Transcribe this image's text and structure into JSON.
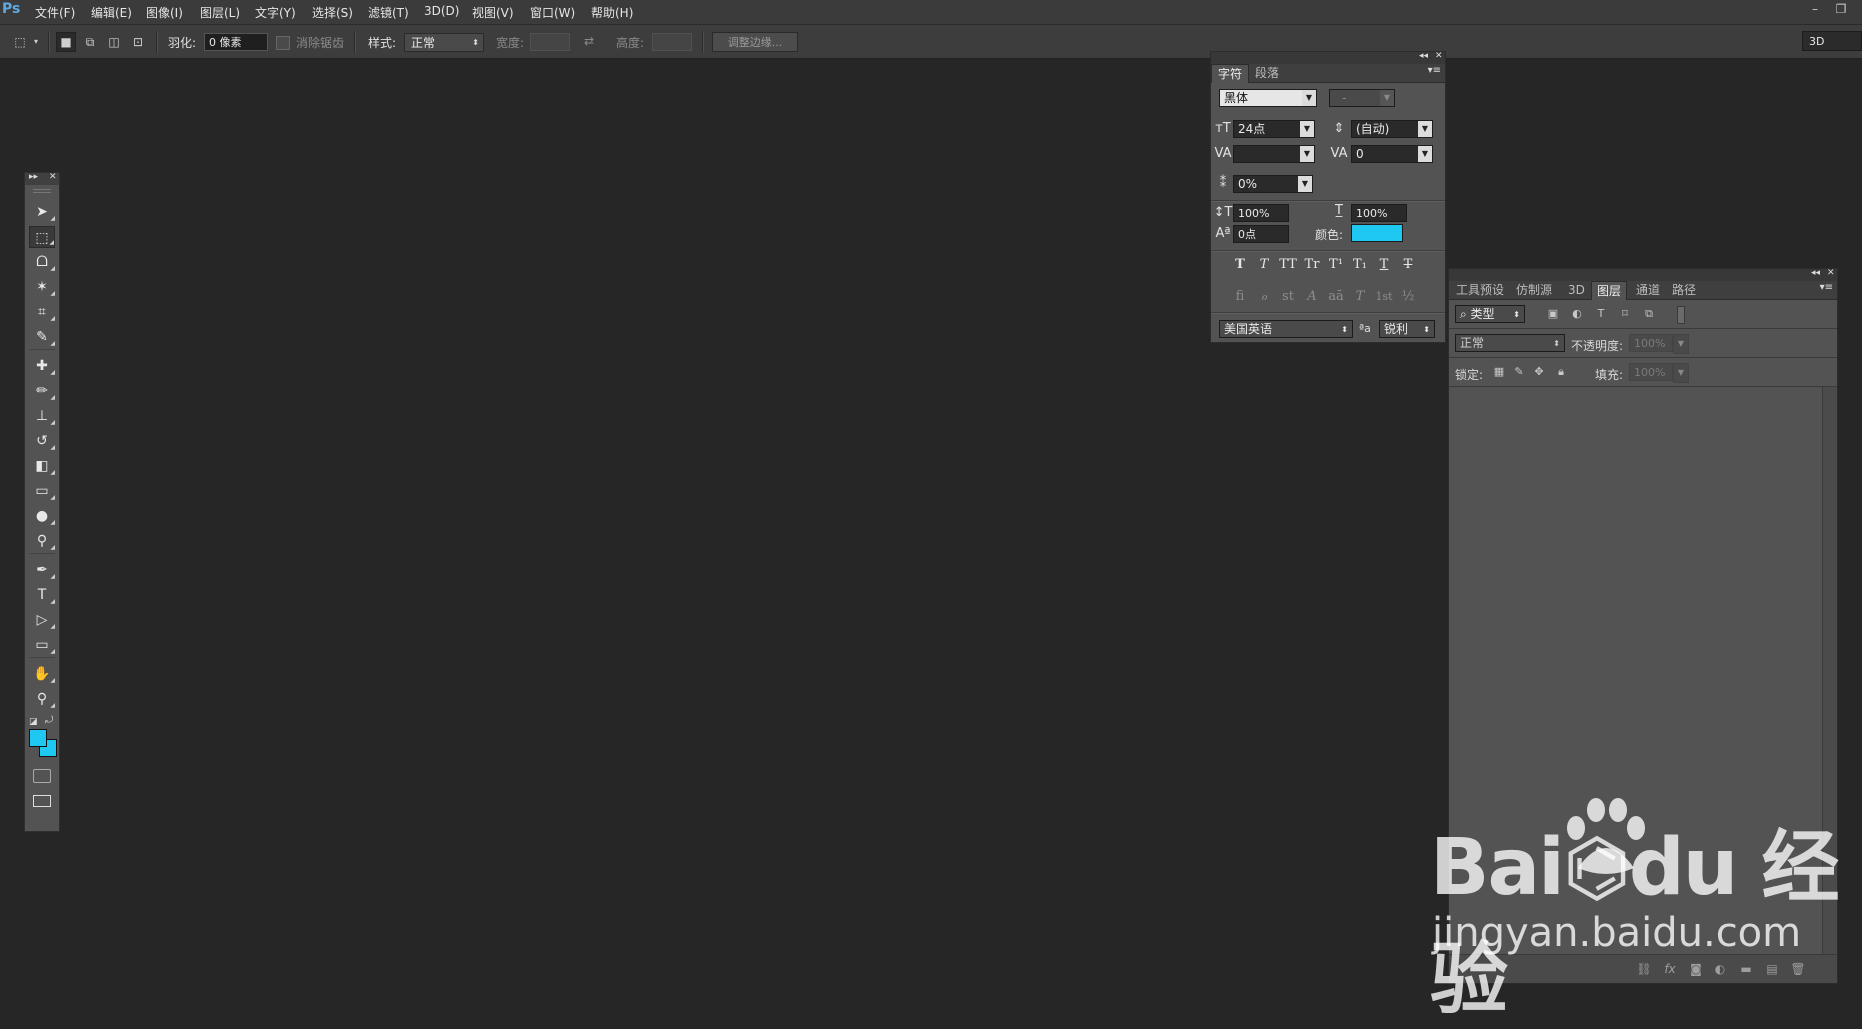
{
  "app": {
    "logo": "Ps"
  },
  "menubar": {
    "items": [
      "文件(F)",
      "编辑(E)",
      "图像(I)",
      "图层(L)",
      "文字(Y)",
      "选择(S)",
      "滤镜(T)",
      "3D(D)",
      "视图(V)",
      "窗口(W)",
      "帮助(H)"
    ],
    "window_controls": [
      "minimize-icon",
      "restore-icon"
    ]
  },
  "options": {
    "feather_label": "羽化:",
    "feather_value": "0 像素",
    "antialias_label": "消除锯齿",
    "style_label": "样式:",
    "style_value": "正常",
    "width_label": "宽度:",
    "height_label": "高度:",
    "refine_edge_label": "调整边缘...",
    "workspace_value": "3D"
  },
  "toolbar": {
    "tools": [
      {
        "name": "move-tool-icon",
        "glyph": "➤"
      },
      {
        "name": "marquee-tool-icon",
        "glyph": "⬚"
      },
      {
        "name": "lasso-tool-icon",
        "glyph": "ᗝ"
      },
      {
        "name": "magic-wand-tool-icon",
        "glyph": "✶"
      },
      {
        "name": "crop-tool-icon",
        "glyph": "⌗"
      },
      {
        "name": "eyedropper-tool-icon",
        "glyph": "✎"
      },
      {
        "name": "healing-brush-tool-icon",
        "glyph": "✚"
      },
      {
        "name": "brush-tool-icon",
        "glyph": "✏"
      },
      {
        "name": "clone-stamp-tool-icon",
        "glyph": "⊥"
      },
      {
        "name": "history-brush-tool-icon",
        "glyph": "↺"
      },
      {
        "name": "eraser-tool-icon",
        "glyph": "◧"
      },
      {
        "name": "gradient-tool-icon",
        "glyph": "▭"
      },
      {
        "name": "blur-tool-icon",
        "glyph": "●"
      },
      {
        "name": "dodge-tool-icon",
        "glyph": "⚲"
      },
      {
        "name": "pen-tool-icon",
        "glyph": "✒"
      },
      {
        "name": "type-tool-icon",
        "glyph": "T"
      },
      {
        "name": "path-selection-tool-icon",
        "glyph": "▷"
      },
      {
        "name": "rectangle-tool-icon",
        "glyph": "▭"
      },
      {
        "name": "hand-tool-icon",
        "glyph": "✋"
      },
      {
        "name": "zoom-tool-icon",
        "glyph": "⚲"
      }
    ],
    "foreground_color": "#1ec8f0",
    "background_color": "#1ec8f0"
  },
  "character_panel": {
    "tabs": [
      "字符",
      "段落"
    ],
    "font_family": "黑体",
    "font_style": "-",
    "font_size": "24点",
    "leading": "(自动)",
    "kerning": "",
    "tracking": "0",
    "tsume": "0%",
    "vertical_scale": "100%",
    "horizontal_scale": "100%",
    "baseline_shift": "0点",
    "color_label": "颜色:",
    "color_value": "#1ec8f0",
    "format_buttons": [
      "T",
      "T",
      "TT",
      "Tr",
      "T¹",
      "T₁",
      "T",
      "T"
    ],
    "opentype_buttons": [
      "fi",
      "ℴ",
      "st",
      "A",
      "aā",
      "T",
      "1st",
      "½"
    ],
    "language": "美国英语",
    "aa_label": "ªa",
    "antialias": "锐利"
  },
  "layers_panel": {
    "tabs": [
      "工具预设",
      "仿制源",
      "3D",
      "图层",
      "通道",
      "路径"
    ],
    "active_tab": "图层",
    "filter_kind": "类型",
    "blend_mode": "正常",
    "opacity_label": "不透明度:",
    "opacity_value": "100%",
    "lock_label": "锁定:",
    "fill_label": "填充:",
    "fill_value": "100%"
  },
  "watermark": {
    "big": "Bai⌬du 经验",
    "url": "jingyan.baidu.com"
  }
}
